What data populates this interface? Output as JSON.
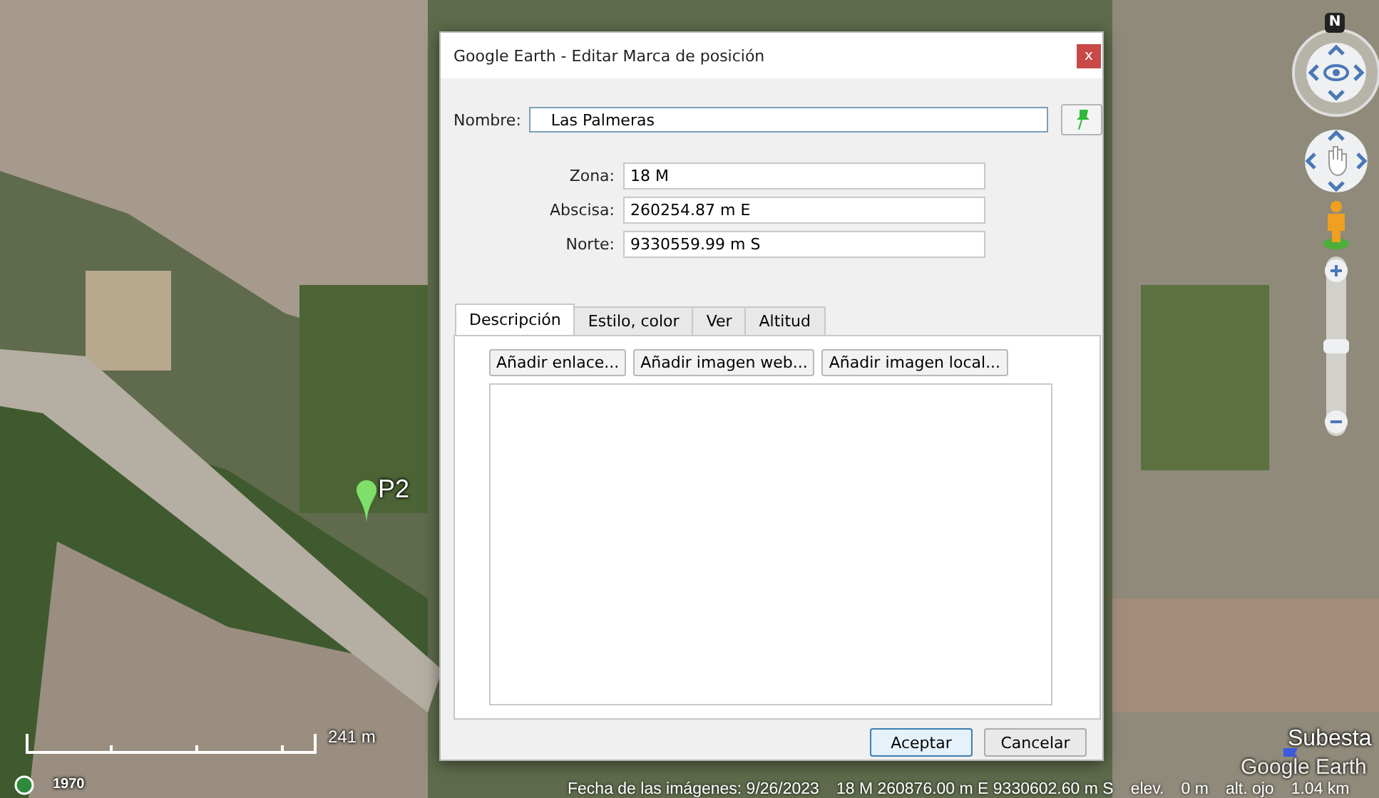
{
  "map": {
    "compass": "N",
    "zoom": {
      "level": 0.5
    },
    "placemark": "P2",
    "place_label": "Subesta",
    "scale": "241 m",
    "year": "1970",
    "logo": "Google Earth",
    "status": [
      "Fecha de las imágenes: 9/26/2023",
      "18 M 260876.00 m E 9330602.60 m S",
      "elev.",
      "0 m",
      "alt. ojo",
      "1.04 km"
    ]
  },
  "dialog": {
    "title": "Google Earth - Editar Marca de posición",
    "close": "x",
    "name_label": "Nombre:",
    "name_value": "Las Palmeras",
    "fields": [
      {
        "label": "Zona:",
        "value": "18 M"
      },
      {
        "label": "Abscisa:",
        "value": "260254.87 m E"
      },
      {
        "label": "Norte:",
        "value": "9330559.99 m S"
      }
    ],
    "tabs": [
      {
        "label": "Descripción",
        "selected": true
      },
      {
        "label": "Estilo, color",
        "selected": false
      },
      {
        "label": "Ver",
        "selected": false
      },
      {
        "label": "Altitud",
        "selected": false
      }
    ],
    "insert_buttons": [
      "Añadir enlace...",
      "Añadir imagen web...",
      "Añadir imagen local..."
    ],
    "buttons": [
      {
        "label": "Aceptar",
        "default": true
      },
      {
        "label": "Cancelar",
        "default": false
      }
    ]
  }
}
